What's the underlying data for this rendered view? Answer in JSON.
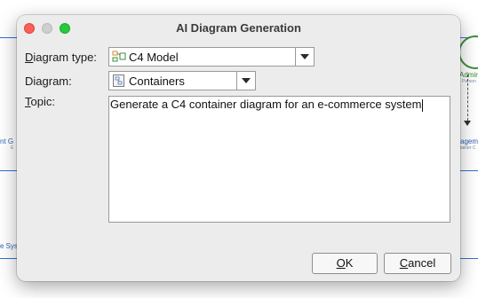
{
  "dialog": {
    "title": "AI Diagram Generation",
    "diagram_type": {
      "label_mnemonic": "D",
      "label_rest": "iagram type:",
      "value": "C4 Model",
      "icon": "c4-model-icon"
    },
    "diagram": {
      "label": "Diagram:",
      "value": "Containers",
      "icon": "container-diagram-icon"
    },
    "topic": {
      "label_mnemonic": "T",
      "label_rest": "opic:",
      "value": "Generate a C4 container diagram for an e-commerce system"
    },
    "buttons": {
      "ok": {
        "mnemonic": "O",
        "rest": "K"
      },
      "cancel": {
        "mnemonic": "C",
        "rest": "ancel"
      }
    }
  },
  "background": {
    "left_label_1": "nt G",
    "left_label_2": "E",
    "left_label_3": "e Sys",
    "right_label_1": "Admir",
    "right_label_2": "Person",
    "right_label_3": "ageme",
    "right_label_4": "tainer C"
  },
  "colors": {
    "dialog_bg": "#ececec",
    "close_light": "#fe5f57",
    "max_light": "#28c840",
    "diagram_line": "#2f6fd6"
  }
}
